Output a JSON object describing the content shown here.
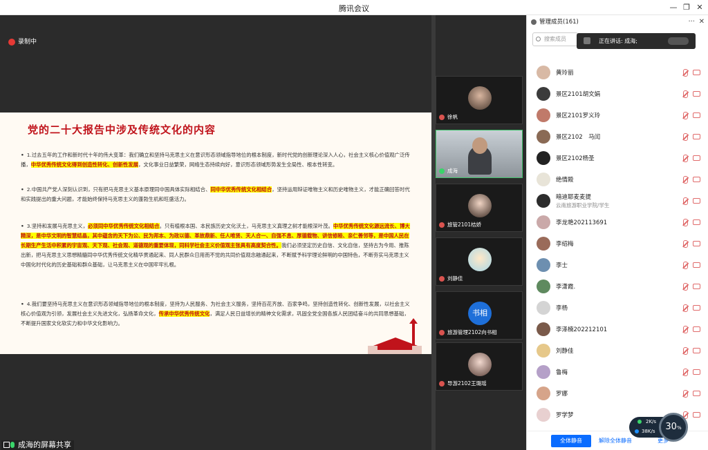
{
  "window": {
    "title": "腾讯会议",
    "min": "—",
    "restore": "❐",
    "close": "✕"
  },
  "recording": {
    "label": "录制中"
  },
  "slide": {
    "title": "党的二十大报告中涉及传统文化的内容",
    "paragraphs": [
      {
        "bullet": "•",
        "pre": "1.过去五年的工作和新时代十年的伟大变革：我们确立和坚持马克思主义在意识形态领域指导地位的根本制度，新时代党的创新理论深入人心，社会主义核心价值观广泛传播，",
        "hl": "中华优秀传统文化得到创造性转化、创新性发展",
        "post": "，文化事业日益繁荣，网络生态持续向好，意识形态领域形势发生全局性、根本性转变。"
      },
      {
        "bullet": "•",
        "pre": "2.中国共产党人深刻认识到，只有把马克思主义基本原理同中国具体实际相结合、",
        "hl": "同中华优秀传统文化相结合",
        "post": "，坚持运用辩证唯物主义和历史唯物主义，才能正确回答时代和实践提出的重大问题，才能始终保持马克思主义的蓬勃生机和旺盛活力。"
      },
      {
        "bullet": "•",
        "pre": "3.坚持和发展马克思主义，",
        "hl": "必须同中华优秀传统文化相结合",
        "mid": "。只有植根本国、本民族历史文化沃土，马克思主义真理之树才能根深叶茂。",
        "hl2": "中华优秀传统文化源远流长、博大精深，是中华文明的智慧结晶，其中蕴含的天下为公、民为邦本、为政以德、革故鼎新、任人唯贤、天人合一、自强不息、厚德载物、讲信修睦、亲仁善邻等，是中国人民在长期生产生活中积累的宇宙观、天下观、社会观、道德观的重要体现，同科学社会主义价值观主张具有高度契合性。",
        "post": "我们必须坚定历史自信、文化自信，坚持古为今用、推陈出新，把马克思主义思想精髓同中华优秀传统文化精华贯通起来、同人民群众日用而不觉的共同价值观念融通起来，不断赋予科学理论鲜明的中国特色，不断夯实马克思主义中国化时代化的历史基础和群众基础，让马克思主义在中国牢牢扎根。"
      },
      {
        "bullet": "•",
        "pre": "4.我们要坚持马克思主义在意识形态领域指导地位的根本制度，坚持为人民服务、为社会主义服务，坚持百花齐放、百家争鸣，坚持创造性转化、创新性发展，以社会主义核心价值观为引领，发展社会主义先进文化，弘扬革命文化，",
        "hl": "传承中华优秀传统文化",
        "post": "，满足人民日益增长的精神文化需求，巩固全党全国各族人民团结奋斗的共同思想基础，不断提升国家文化软实力和中华文化影响力。"
      }
    ]
  },
  "share_label": "成海的屏幕共享",
  "tiles": [
    {
      "name": "徐帆",
      "mic_on": false
    },
    {
      "name": "成海",
      "mic_on": true
    },
    {
      "name": "旅管2101桔娇",
      "mic_on": false
    },
    {
      "name": "刘静佳",
      "mic_on": false
    },
    {
      "name": "旅游管理2102向书相",
      "mic_on": false,
      "avatar_text": "书相"
    },
    {
      "name": "导游2102王璐瑶",
      "mic_on": false
    }
  ],
  "panel": {
    "title": "管理成员(161)",
    "more": "···",
    "close": "✕",
    "search_placeholder": "搜索成员",
    "toast": "正在讲话: 成海;",
    "members": [
      {
        "name": "黄玲丽",
        "color": "#d8b9a5"
      },
      {
        "name": "景区2101胡文娟",
        "color": "#3b3b3b"
      },
      {
        "name": "景区2101罗义玲",
        "color": "#c07a6a"
      },
      {
        "name": "景区2102　马闰",
        "color": "#8a6a55"
      },
      {
        "name": "景区2102杨圣",
        "color": "#222222"
      },
      {
        "name": "绝情殿",
        "color": "#e8e4d8"
      },
      {
        "name": "暗迪耶麦麦提",
        "sub": "云南旅游职业学院/学生",
        "color": "#2c2c2c"
      },
      {
        "name": "李龙艳202113691",
        "color": "#caa9a9"
      },
      {
        "name": "李绍梅",
        "color": "#9a6b5a"
      },
      {
        "name": "李士",
        "color": "#6d8fb0"
      },
      {
        "name": "李潇霞.",
        "color": "#5f8a5f"
      },
      {
        "name": "李杨",
        "color": "#d4d4d4"
      },
      {
        "name": "李泽楠202212101",
        "color": "#7a5a4a"
      },
      {
        "name": "刘静佳",
        "color": "#e6c88a"
      },
      {
        "name": "鲁梅",
        "color": "#b5a0c8"
      },
      {
        "name": "罗娜",
        "color": "#d6a48a"
      },
      {
        "name": "罗学梦",
        "color": "#e8d0d0"
      }
    ],
    "footer": {
      "mute_all": "全体静音",
      "unmute_all": "解除全体静音",
      "more": "更多"
    }
  },
  "network": {
    "up": "2K/s",
    "down": "38K/s"
  },
  "cpu": {
    "value": "30",
    "unit": "%"
  }
}
